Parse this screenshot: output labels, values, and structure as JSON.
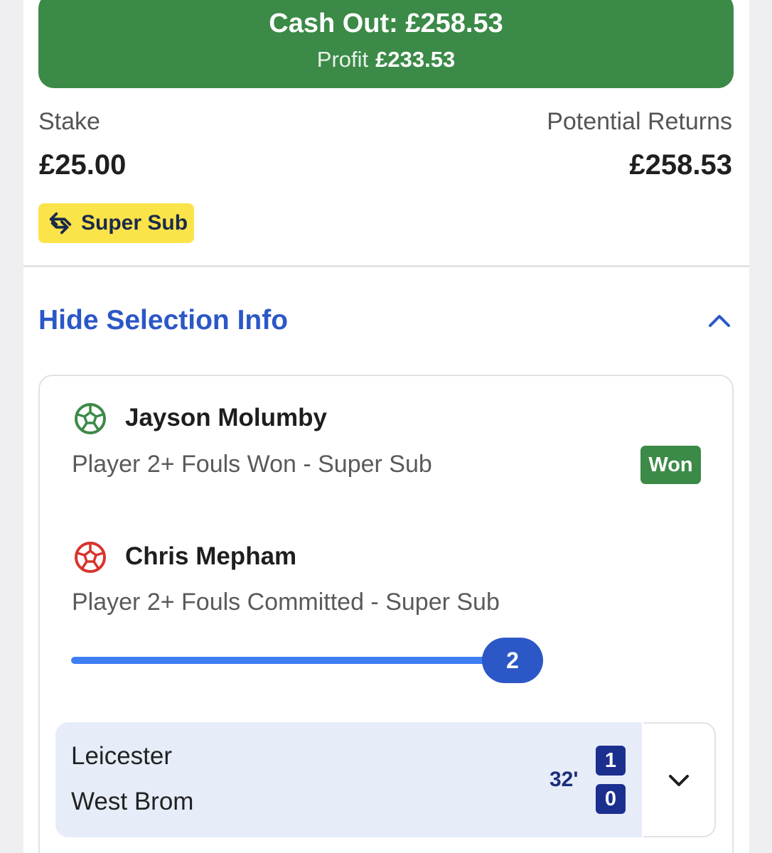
{
  "cashout": {
    "label": "Cash Out: £258.53",
    "profit_label": "Profit",
    "profit_value": "£233.53",
    "color": "#3b8a47"
  },
  "stake": {
    "label": "Stake",
    "value": "£25.00"
  },
  "returns": {
    "label": "Potential Returns",
    "value": "£258.53"
  },
  "badge": {
    "label": "Super Sub",
    "icon": "swap-arrows-icon",
    "color": "#fbe34a"
  },
  "selection_toggle": {
    "label": "Hide Selection Info",
    "icon": "chevron-up-icon",
    "color": "#2b57c7"
  },
  "selections": [
    {
      "player": "Jayson Molumby",
      "icon": "football-green-icon",
      "market": "Player 2+ Fouls Won - Super Sub",
      "status": "Won"
    },
    {
      "player": "Chris Mepham",
      "icon": "football-red-icon",
      "market": "Player 2+ Fouls Committed - Super Sub",
      "progress_value": "2",
      "progress_fraction": 1.0
    }
  ],
  "match": {
    "home_team": "Leicester",
    "away_team": "West Brom",
    "minute": "32'",
    "home_score": "1",
    "away_score": "0",
    "expand_icon": "chevron-down-icon"
  }
}
